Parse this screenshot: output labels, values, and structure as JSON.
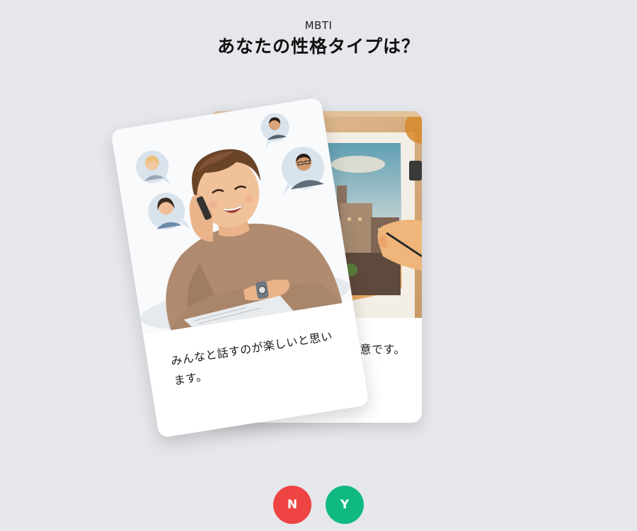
{
  "header": {
    "subtitle": "MBTI",
    "title": "あなたの性格タイプは？"
  },
  "cards": {
    "front": {
      "text": "みんなと話すのが楽しいと思います。",
      "illustration": "person-on-phone-with-friends-illustration"
    },
    "back": {
      "text": "スケッチで風景を描くのが得意です。",
      "illustration": "hand-drawing-cityscape-illustration"
    }
  },
  "buttons": {
    "no_label": "N",
    "yes_label": "Y"
  },
  "colors": {
    "background": "#e5e7eb",
    "no": "#ef4444",
    "yes": "#10b981",
    "card": "#ffffff"
  }
}
